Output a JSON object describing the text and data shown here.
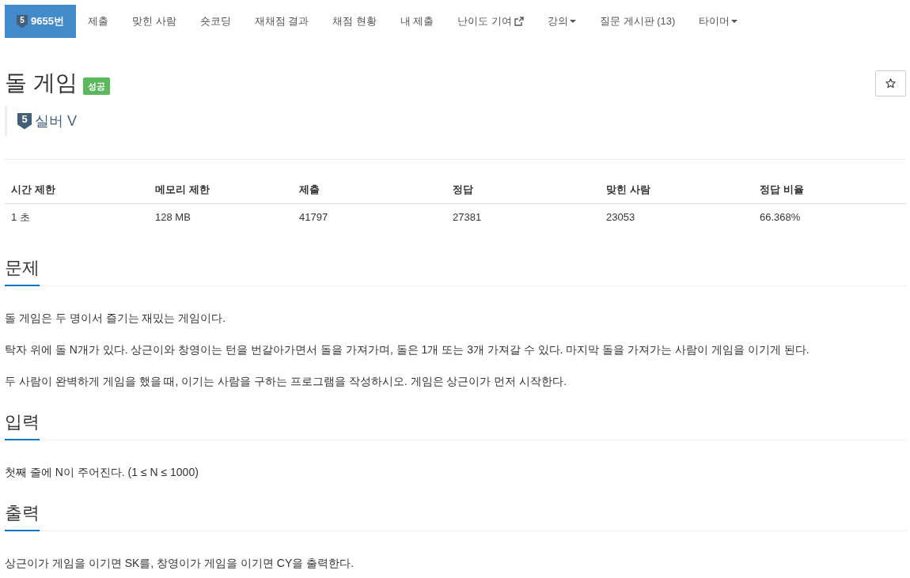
{
  "nav": {
    "items": [
      {
        "label": "9655번",
        "tier": "5",
        "kind": "problem",
        "selected": true
      },
      {
        "label": "제출",
        "kind": "link",
        "selected": false
      },
      {
        "label": "맞힌 사람",
        "kind": "link",
        "selected": false
      },
      {
        "label": "숏코딩",
        "kind": "link",
        "selected": false
      },
      {
        "label": "재채점 결과",
        "kind": "link",
        "selected": false
      },
      {
        "label": "채점 현황",
        "kind": "link",
        "selected": false
      },
      {
        "label": "내 제출",
        "kind": "link",
        "selected": false
      },
      {
        "label": "난이도 기여",
        "kind": "external",
        "selected": false
      },
      {
        "label": "강의",
        "kind": "dropdown",
        "selected": false
      },
      {
        "label": "질문 게시판 (13)",
        "kind": "link",
        "selected": false
      },
      {
        "label": "타이머",
        "kind": "dropdown",
        "selected": false
      }
    ]
  },
  "problem": {
    "title": "돌 게임",
    "status_badge": "성공",
    "starred": false,
    "tier": {
      "number": "5",
      "label": "실버 V"
    }
  },
  "stats": {
    "columns": [
      "시간 제한",
      "메모리 제한",
      "제출",
      "정답",
      "맞힌 사람",
      "정답 비율"
    ],
    "rows": [
      [
        "1 초",
        "128 MB",
        "41797",
        "27381",
        "23053",
        "66.368%"
      ]
    ]
  },
  "sections": [
    {
      "heading": "문제",
      "paragraphs": [
        "돌 게임은 두 명이서 즐기는 재밌는 게임이다.",
        "탁자 위에 돌 N개가 있다. 상근이와 창영이는 턴을 번갈아가면서 돌을 가져가며, 돌은 1개 또는 3개 가져갈 수 있다. 마지막 돌을 가져가는 사람이 게임을 이기게 된다.",
        "두 사람이 완벽하게 게임을 했을 때, 이기는 사람을 구하는 프로그램을 작성하시오. 게임은 상근이가 먼저 시작한다."
      ]
    },
    {
      "heading": "입력",
      "paragraphs": [
        "첫째 줄에 N이 주어진다. (1 ≤ N ≤ 1000)"
      ]
    },
    {
      "heading": "출력",
      "paragraphs": [
        "상근이가 게임을 이기면 SK를, 창영이가 게임을 이기면 CY을 출력한다."
      ]
    }
  ]
}
